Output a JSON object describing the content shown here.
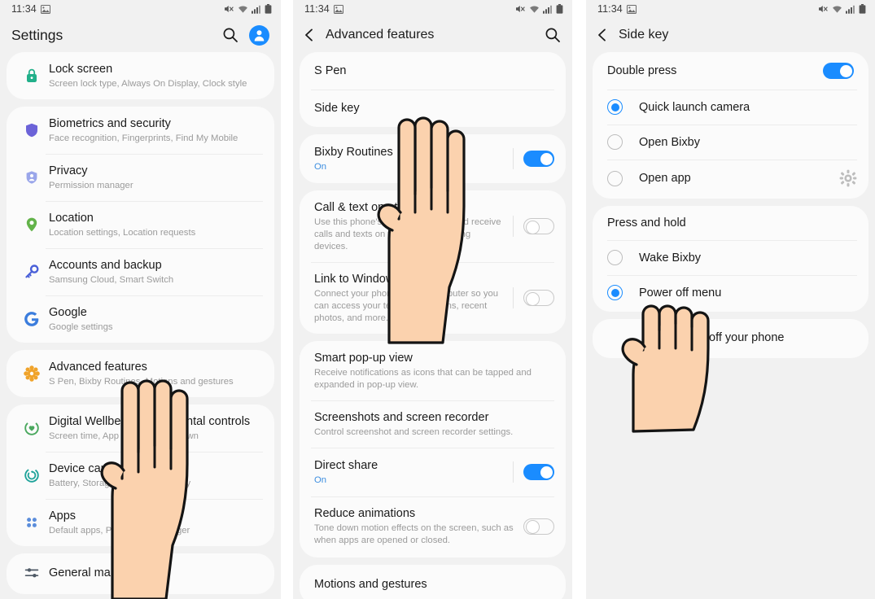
{
  "status_bar": {
    "time": "11:34",
    "icons": [
      "screenshot-icon",
      "mute-icon",
      "wifi-icon",
      "signal-icon",
      "battery-icon"
    ]
  },
  "colors": {
    "accent": "#1a8cff",
    "background": "#f1f1f1",
    "card": "#fbfbfb",
    "on_label": "#3d8ee0"
  },
  "panel1": {
    "title": "Settings",
    "groups": [
      {
        "rows": [
          {
            "title": "Lock screen",
            "sub": "Screen lock type, Always On Display, Clock style",
            "icon": "lock-icon"
          }
        ]
      },
      {
        "rows": [
          {
            "title": "Biometrics and security",
            "sub": "Face recognition, Fingerprints, Find My Mobile",
            "icon": "shield-icon"
          },
          {
            "title": "Privacy",
            "sub": "Permission manager",
            "icon": "privacy-shield-icon"
          },
          {
            "title": "Location",
            "sub": "Location settings, Location requests",
            "icon": "location-pin-icon"
          },
          {
            "title": "Accounts and backup",
            "sub": "Samsung Cloud, Smart Switch",
            "icon": "key-icon"
          },
          {
            "title": "Google",
            "sub": "Google settings",
            "icon": "google-icon"
          }
        ]
      },
      {
        "rows": [
          {
            "title": "Advanced features",
            "sub": "S Pen, Bixby Routines, Motions and gestures",
            "icon": "advanced-features-icon"
          }
        ]
      },
      {
        "rows": [
          {
            "title": "Digital Wellbeing and parental controls",
            "sub": "Screen time, App timers, Wind Down",
            "icon": "wellbeing-icon"
          },
          {
            "title": "Device care",
            "sub": "Battery, Storage, Memory, Security",
            "icon": "device-care-icon"
          },
          {
            "title": "Apps",
            "sub": "Default apps, Permission manager",
            "icon": "apps-icon"
          }
        ]
      },
      {
        "rows": [
          {
            "title": "General management",
            "sub": "",
            "icon": "sliders-icon"
          }
        ]
      }
    ]
  },
  "panel2": {
    "title": "Advanced features",
    "groups": [
      {
        "rows": [
          {
            "title": "S Pen",
            "sub": "",
            "control": "none"
          },
          {
            "title": "Side key",
            "sub": "",
            "control": "none"
          }
        ]
      },
      {
        "rows": [
          {
            "title": "Bixby Routines",
            "sub": "On",
            "sub_style": "on",
            "control": "toggle",
            "toggle": "on"
          }
        ]
      },
      {
        "rows": [
          {
            "title": "Call & text on other devices",
            "sub": "Use this phone's number to make and receive calls and texts on your other Samsung devices.",
            "control": "toggle",
            "toggle": "off"
          },
          {
            "title": "Link to Windows",
            "sub": "Connect your phone to your computer so you can access your texts, notifications, recent photos, and more.",
            "control": "toggle",
            "toggle": "off"
          }
        ]
      },
      {
        "rows": [
          {
            "title": "Smart pop-up view",
            "sub": "Receive notifications as icons that can be tapped and expanded in pop-up view.",
            "control": "none"
          },
          {
            "title": "Screenshots and screen recorder",
            "sub": "Control screenshot and screen recorder settings.",
            "control": "none"
          },
          {
            "title": "Direct share",
            "sub": "On",
            "sub_style": "on",
            "control": "toggle",
            "toggle": "on"
          },
          {
            "title": "Reduce animations",
            "sub": "Tone down motion effects on the screen, such as when apps are opened or closed.",
            "control": "toggle",
            "toggle": "off"
          }
        ]
      },
      {
        "rows": [
          {
            "title": "Motions and gestures",
            "sub": "",
            "control": "none"
          }
        ]
      }
    ]
  },
  "panel3": {
    "title": "Side key",
    "section1": {
      "header": "Double press",
      "toggle": "on",
      "options": [
        {
          "label": "Quick launch camera",
          "selected": true,
          "trailing": "none"
        },
        {
          "label": "Open Bixby",
          "selected": false,
          "trailing": "none"
        },
        {
          "label": "Open app",
          "selected": false,
          "trailing": "gear-icon"
        }
      ]
    },
    "section2": {
      "header": "Press and hold",
      "options": [
        {
          "label": "Wake Bixby",
          "selected": false
        },
        {
          "label": "Power off menu",
          "selected": true
        }
      ]
    },
    "section3": {
      "label": "off your phone"
    }
  }
}
